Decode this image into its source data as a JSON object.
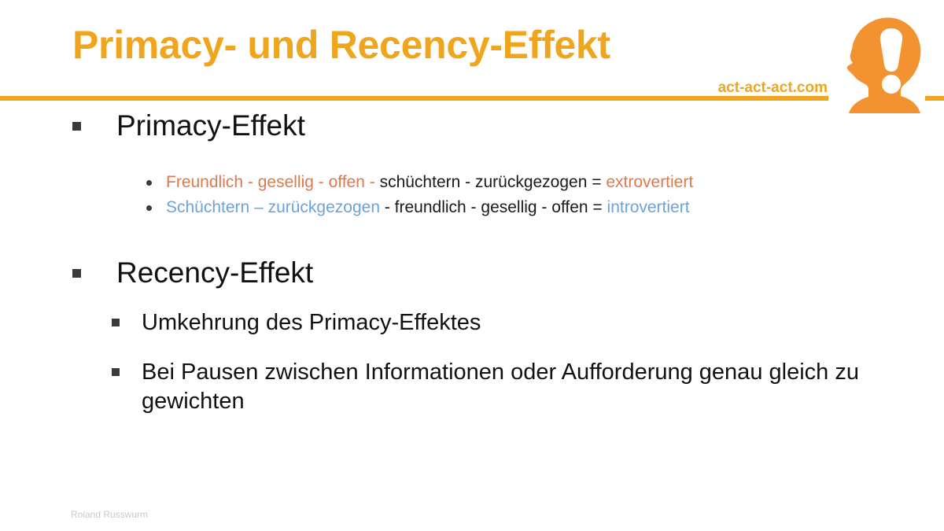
{
  "slide": {
    "title": "Primacy- und Recency-Effekt",
    "site_url": "act-act-act.com",
    "footer": "Roland Russwurm",
    "logo_icon": "head-exclamation-logo-icon",
    "colors": {
      "accent_orange": "#efa61e",
      "text_orange": "#e0794a",
      "text_blue": "#6ba3dc",
      "bullet_gray": "#3a3a3a",
      "body_text": "#111111",
      "footer_text": "#c9c9c9",
      "background": "#ffffff"
    }
  },
  "sections": [
    {
      "heading": "Primacy-Effekt",
      "bullets": [
        {
          "parts": [
            {
              "text": "Freundlich - gesellig - offen - ",
              "style": "orange"
            },
            {
              "text": "schüchtern - zurückgezogen = ",
              "style": "plain"
            },
            {
              "text": "extrovertiert",
              "style": "orange"
            }
          ]
        },
        {
          "parts": [
            {
              "text": "Schüchtern – zurückgezogen ",
              "style": "blue"
            },
            {
              "text": "- freundlich - gesellig - offen = ",
              "style": "plain"
            },
            {
              "text": "introvertiert",
              "style": "blue"
            }
          ]
        }
      ]
    },
    {
      "heading": "Recency-Effekt",
      "bullets": [
        {
          "parts": [
            {
              "text": "Umkehrung des Primacy-Effektes",
              "style": "plain"
            }
          ]
        },
        {
          "parts": [
            {
              "text": "Bei Pausen zwischen Informationen oder Aufforderung genau gleich zu gewichten",
              "style": "plain"
            }
          ]
        }
      ]
    }
  ]
}
